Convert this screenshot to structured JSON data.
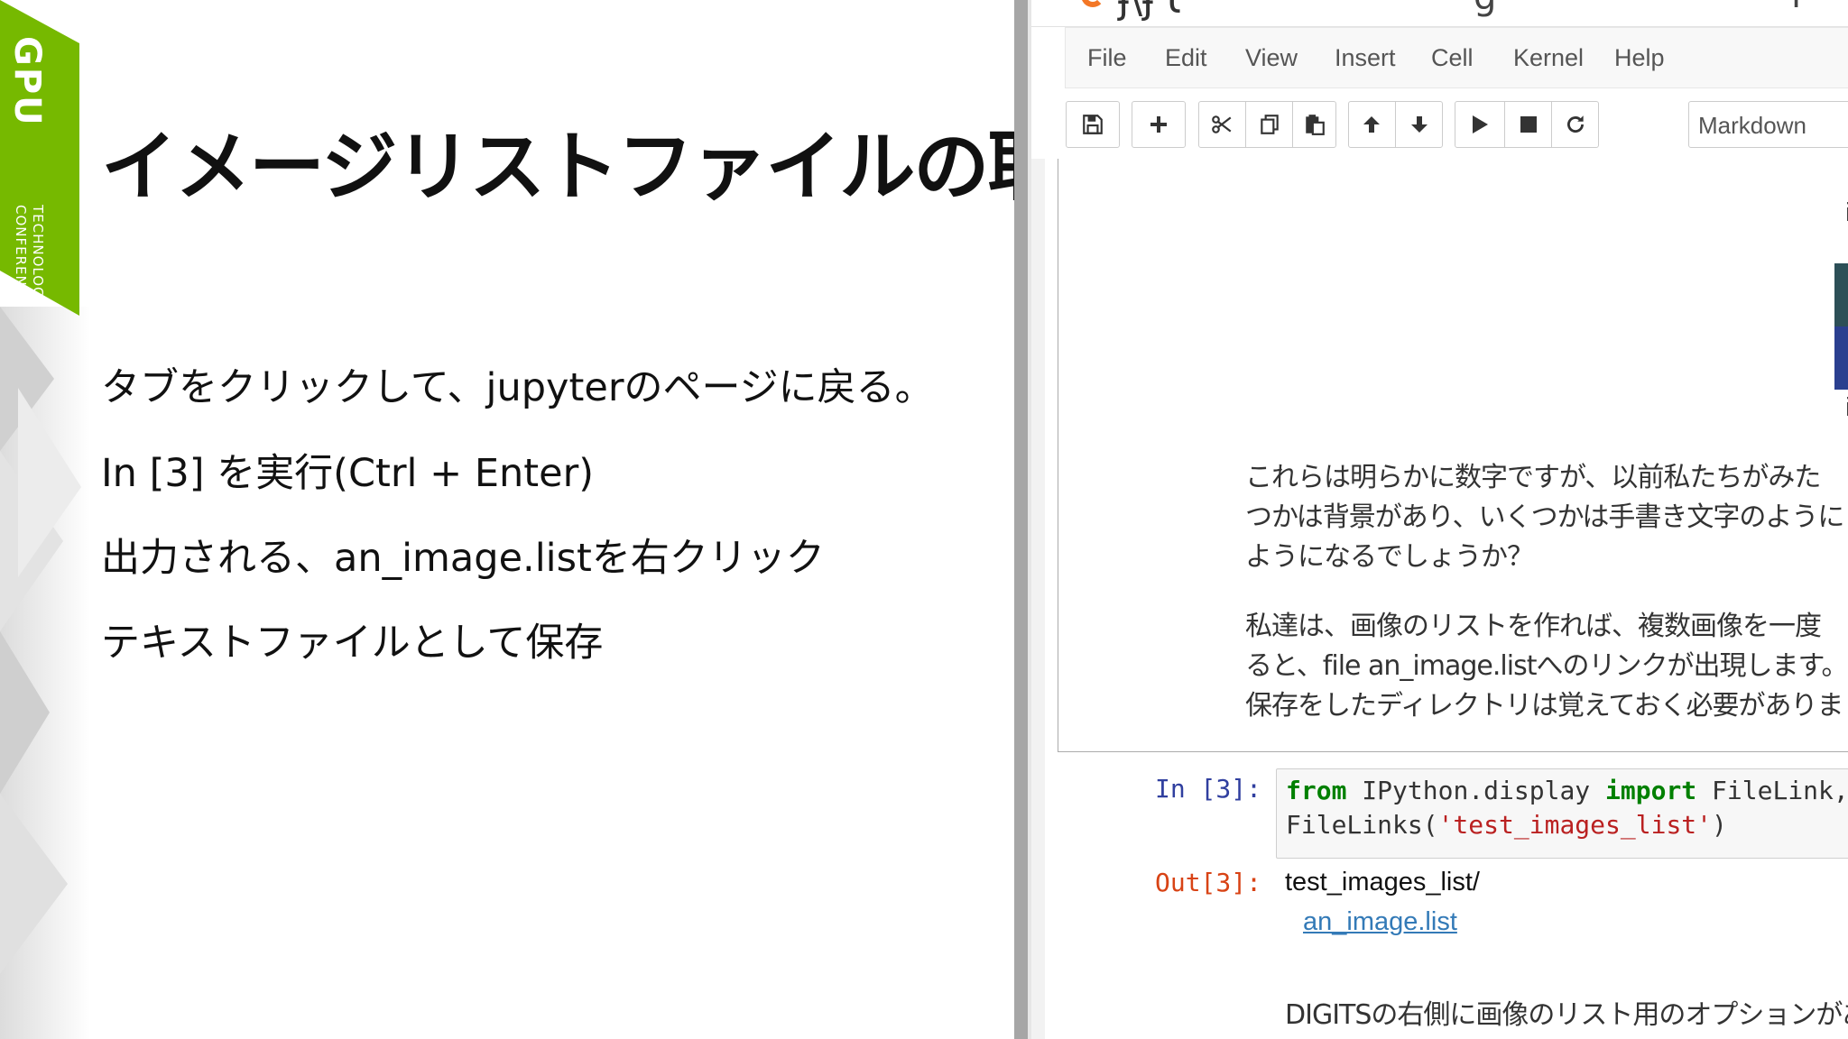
{
  "slide": {
    "badge": {
      "brand": "GPU",
      "sub_line1": "TECHNOLOGY",
      "sub_line2": "CONFERENCE",
      "color": "#76b900"
    },
    "title": "イメージリストファイルの取得",
    "bullets": [
      "タブをクリックして、jupyterのページに戻る。",
      "In [3] を実行(Ctrl + Enter)",
      "出力される、an_image.listを右クリック",
      "テキストファイルとして保存"
    ]
  },
  "jupyter": {
    "menu": [
      "File",
      "Edit",
      "View",
      "Insert",
      "Cell",
      "Kernel",
      "Help"
    ],
    "toolbar_icons": [
      "save-icon",
      "plus-icon",
      "scissors-icon",
      "copy-icon",
      "paste-icon",
      "arrow-up-icon",
      "arrow-down-icon",
      "play-icon",
      "stop-icon",
      "restart-icon"
    ],
    "cell_type": "Markdown",
    "markdown": {
      "image_caption_1": "ima",
      "image_caption_2": "ima",
      "paragraph1": [
        "これらは明らかに数字ですが、以前私たちがみた",
        "つかは背景があり、いくつかは手書き文字のように",
        "ようになるでしょうか？"
      ],
      "paragraph2": [
        "私達は、画像のリストを作れば、複数画像を一度",
        "ると、file an_image.listへのリンクが出現します。",
        "保存をしたディレクトリは覚えておく必要がありま"
      ]
    },
    "code_cell": {
      "in_prompt": "In [3]:",
      "line1": {
        "kw_from": "from",
        "module": " IPython.display ",
        "kw_import": "import",
        "rest": " FileLink, Fi"
      },
      "line2": {
        "func": "FileLinks",
        "open": "(",
        "arg": "'test_images_list'",
        "close": ")"
      },
      "out_prompt": "Out[3]:",
      "output_dir": "test_images_list/",
      "output_link": "an_image.list"
    },
    "trailing_text": "DIGITSの右側に画像のリスト用のオプションがあ"
  }
}
